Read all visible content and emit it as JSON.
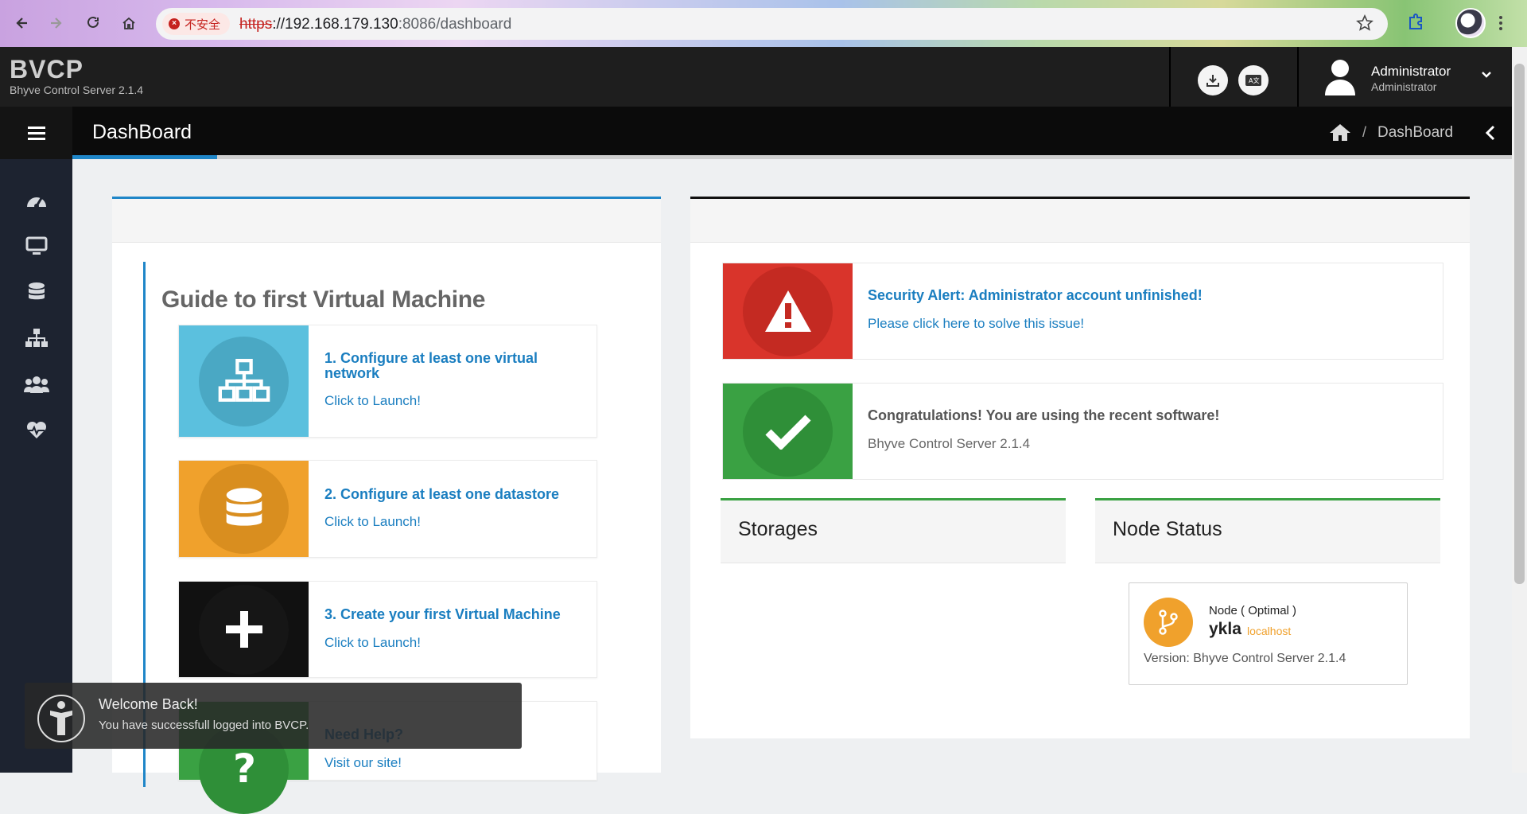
{
  "browser": {
    "security_label": "不安全",
    "url_scheme": "https",
    "url_host": "://192.168.179.130",
    "url_rest": ":8086/dashboard"
  },
  "app": {
    "brand": "BVCP",
    "subtitle": "Bhyve Control Server 2.1.4",
    "user_name": "Administrator",
    "user_role": "Administrator"
  },
  "sidebar": {
    "items": [
      {
        "icon": "dashboard-gauge-icon"
      },
      {
        "icon": "monitor-icon"
      },
      {
        "icon": "database-icon"
      },
      {
        "icon": "network-icon"
      },
      {
        "icon": "users-icon"
      },
      {
        "icon": "heartbeat-icon"
      }
    ]
  },
  "page": {
    "title": "DashBoard",
    "breadcrumb_current": "DashBoard",
    "breadcrumb_separator": "/"
  },
  "guide": {
    "title": "Guide to first Virtual Machine",
    "steps": [
      {
        "title": "1. Configure at least one virtual network",
        "link": "Click to Launch!",
        "color": "#5bc0de",
        "icon": "network-icon"
      },
      {
        "title": "2. Configure at least one datastore",
        "link": "Click to Launch!",
        "color": "#f0a12c",
        "icon": "database-icon"
      },
      {
        "title": "3. Create your first Virtual Machine",
        "link": "Click to Launch!",
        "color": "#111111",
        "icon": "plus-icon"
      },
      {
        "title": "Need Help?",
        "link": "Visit our site!",
        "color": "#3aa143",
        "icon": "question-icon"
      }
    ]
  },
  "alerts": [
    {
      "title": "Security Alert: Administrator account unfinished!",
      "message": "Please click here to solve this issue!",
      "color": "#d9342b"
    },
    {
      "title": "Congratulations! You are using the recent software!",
      "message": "Bhyve Control Server 2.1.4",
      "color": "#3aa143"
    }
  ],
  "storages": {
    "title": "Storages"
  },
  "node_status": {
    "title": "Node Status",
    "state": "Node ( Optimal )",
    "name": "ykla",
    "host": "localhost",
    "version": "Version: Bhyve Control Server 2.1.4"
  },
  "toast": {
    "title": "Welcome Back!",
    "message": "You have successfull logged into BVCP."
  }
}
